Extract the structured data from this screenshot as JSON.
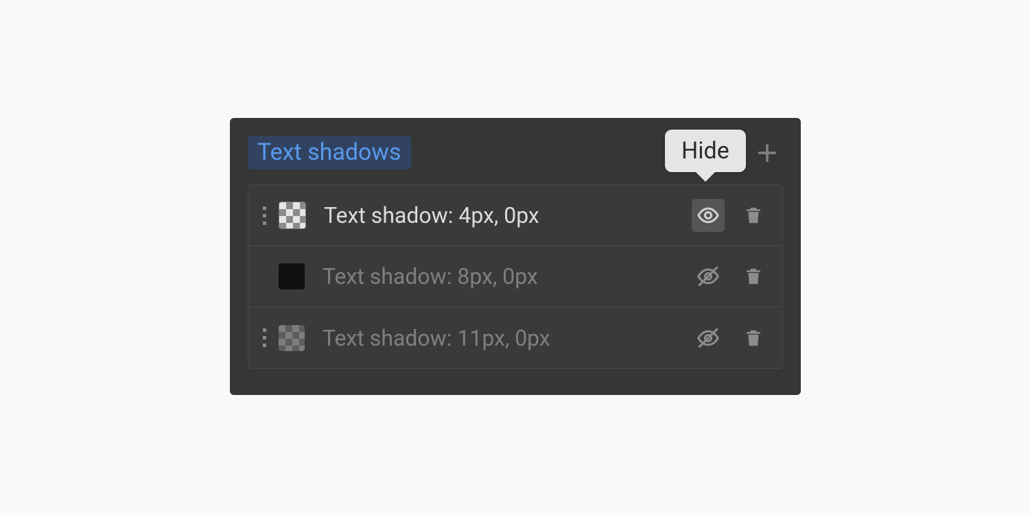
{
  "panel": {
    "title": "Text shadows",
    "tooltip": "Hide"
  },
  "shadows": [
    {
      "label": "Text shadow: 4px, 0px",
      "swatch": "checker-light",
      "draggable": true,
      "visible": true,
      "active_toggle": true
    },
    {
      "label": "Text shadow: 8px, 0px",
      "swatch": "solid-black",
      "draggable": false,
      "visible": false,
      "active_toggle": false
    },
    {
      "label": "Text shadow: 11px, 0px",
      "swatch": "checker-gray",
      "draggable": true,
      "visible": false,
      "active_toggle": false
    }
  ]
}
